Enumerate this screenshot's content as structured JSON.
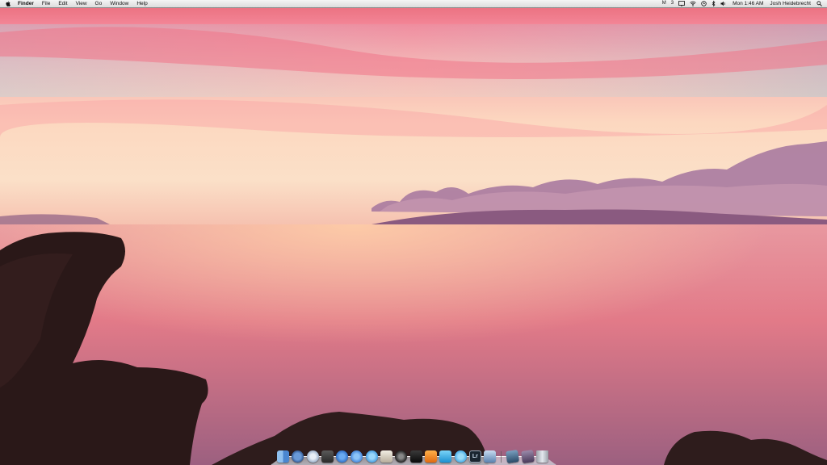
{
  "menubar": {
    "app_name": "Finder",
    "menus": [
      "File",
      "Edit",
      "View",
      "Go",
      "Window",
      "Help"
    ],
    "status": {
      "battery_percent_icon": "M",
      "badge": "3",
      "clock": "Mon 1:46 AM",
      "user": "Josh Heidebrecht"
    }
  },
  "dock": {
    "apps": [
      {
        "name": "Finder",
        "icon": "finder-icon",
        "color": "#5a8fd8"
      },
      {
        "name": "Dashboard",
        "icon": "dashboard-icon",
        "color": "#3b6fb5"
      },
      {
        "name": "Safari",
        "icon": "safari-icon",
        "color": "#c9d6e6"
      },
      {
        "name": "Activity Monitor",
        "icon": "activity-icon",
        "color": "#3a3a3a"
      },
      {
        "name": "App Store",
        "icon": "appstore-icon",
        "color": "#2f7ad6"
      },
      {
        "name": "iTunes",
        "icon": "itunes-icon",
        "color": "#4f8fe0"
      },
      {
        "name": "Messages",
        "icon": "messages-icon",
        "color": "#3fa0f0"
      },
      {
        "name": "Preview",
        "icon": "preview-icon",
        "color": "#d8d0c0"
      },
      {
        "name": "Photo Booth",
        "icon": "photobooth-icon",
        "color": "#333333"
      },
      {
        "name": "Terminal",
        "icon": "terminal-icon",
        "color": "#1e1e1e"
      },
      {
        "name": "Pages",
        "icon": "pages-icon",
        "color": "#f08a1c"
      },
      {
        "name": "Word",
        "icon": "word-icon",
        "color": "#2fa8e0"
      },
      {
        "name": "Twitter",
        "icon": "twitter-icon",
        "color": "#3aa7e8"
      },
      {
        "name": "Lightroom",
        "icon": "lightroom-icon",
        "color": "#1a2530"
      },
      {
        "name": "Photos",
        "icon": "photos-icon",
        "color": "#7aa0c8"
      }
    ],
    "stacks": [
      {
        "name": "Applications",
        "icon": "applications-icon",
        "color": "#4a6a8a"
      },
      {
        "name": "Downloads",
        "icon": "downloads-icon",
        "color": "#6a5a7a"
      },
      {
        "name": "Trash",
        "icon": "trash-icon",
        "color": "#b8bcc4"
      }
    ],
    "lightroom_label": "Lr"
  }
}
